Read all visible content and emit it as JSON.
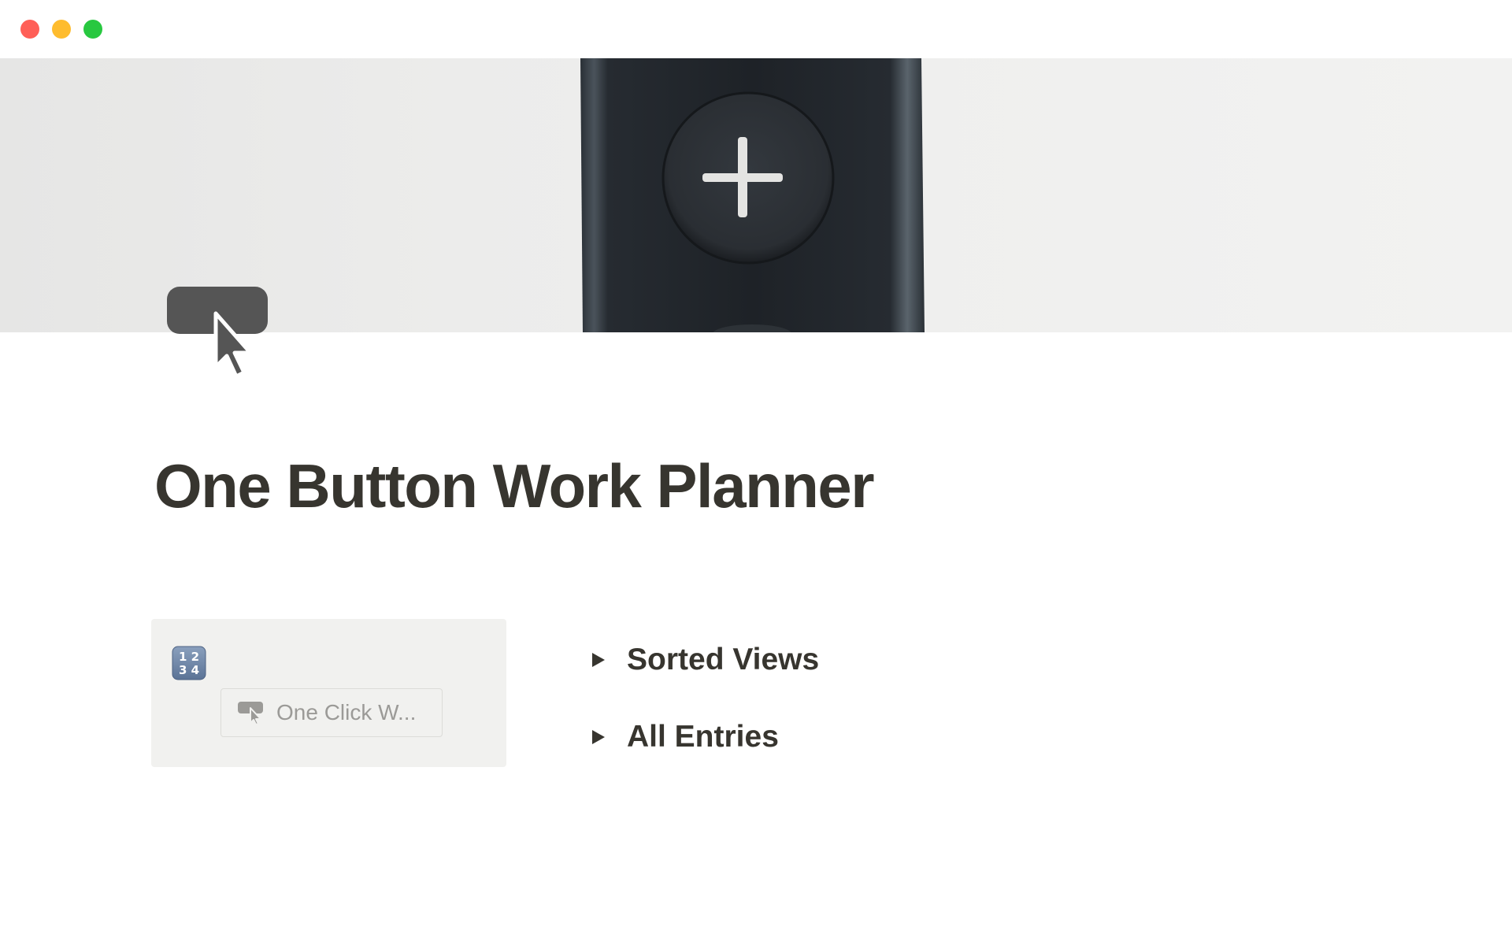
{
  "window": {
    "controls": [
      "close",
      "minimize",
      "zoom"
    ]
  },
  "cover": {
    "image": "remote-control-plus-button"
  },
  "page": {
    "icon": "cursor-click-icon",
    "title": "One Button Work Planner"
  },
  "callout": {
    "icon": "input-numbers-icon",
    "button": {
      "icon": "cursor-click-icon",
      "label": "One Click W..."
    }
  },
  "toggles": [
    {
      "label": "Sorted Views",
      "icon": "triangle-right-icon",
      "expanded": false
    },
    {
      "label": "All Entries",
      "icon": "triangle-right-icon",
      "expanded": false
    }
  ],
  "colors": {
    "text": "#37352f",
    "muted_text": "#9b9a97",
    "callout_bg": "#f1f1ef",
    "close": "#ff5f57",
    "minimize": "#febc2e",
    "zoom": "#28c840"
  }
}
